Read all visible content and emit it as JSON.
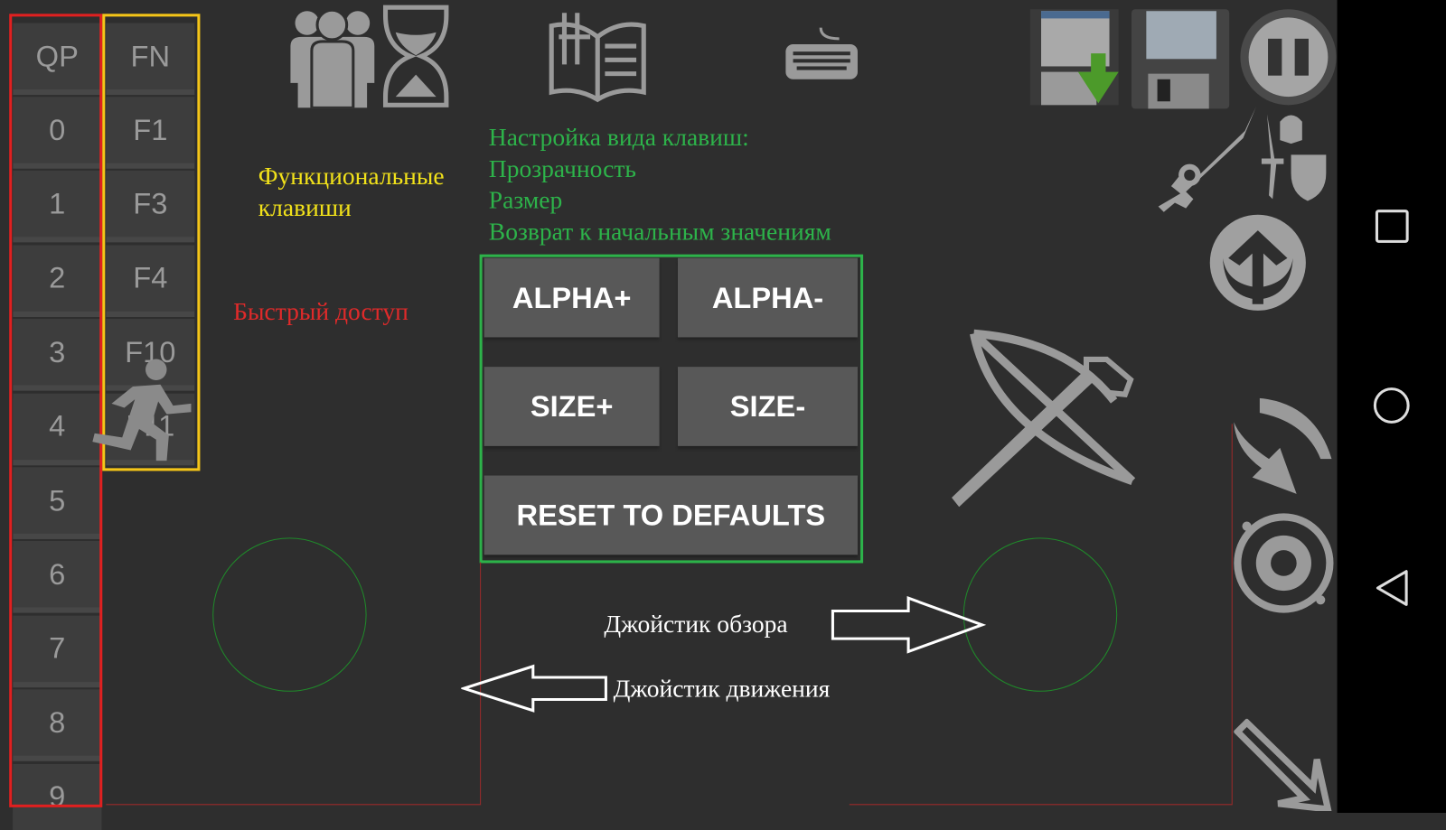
{
  "quick_panel": {
    "header": "QP",
    "keys": [
      "0",
      "1",
      "2",
      "3",
      "4",
      "5",
      "6",
      "7",
      "8",
      "9"
    ],
    "border_color": "#e02020"
  },
  "function_panel": {
    "header": "FN",
    "keys": [
      "F1",
      "F3",
      "F4",
      "F10",
      "F11"
    ],
    "border_color": "#f5c518"
  },
  "annotations": {
    "function_keys": [
      "Функциональные",
      "клавиши"
    ],
    "quick_access": "Быстрый доступ",
    "key_settings": [
      "Настройка вида клавиш:",
      "Прозрачность",
      "Размер",
      "Возврат к начальным значениям"
    ],
    "look_joystick": "Джойстик обзора",
    "move_joystick": "Джойстик движения",
    "yellow": "#f2e21a",
    "red": "#e02a2a",
    "green": "#2db34a"
  },
  "settings_panel": {
    "alpha_plus": "ALPHA+",
    "alpha_minus": "ALPHA-",
    "size_plus": "SIZE+",
    "size_minus": "SIZE-",
    "reset": "RESET TO DEFAULTS"
  },
  "icons": [
    "party-icon",
    "hourglass-icon",
    "journal-book-icon",
    "keyboard-icon",
    "quickload-icon",
    "quicksave-icon",
    "pause-icon",
    "weapon-toggle-icon",
    "jump-icon",
    "crossbow-attack-icon",
    "run-icon",
    "rotate-icon",
    "magic-wheel-icon",
    "sneak-arrow-icon"
  ],
  "nav": [
    "recents-button",
    "home-button",
    "back-button"
  ]
}
